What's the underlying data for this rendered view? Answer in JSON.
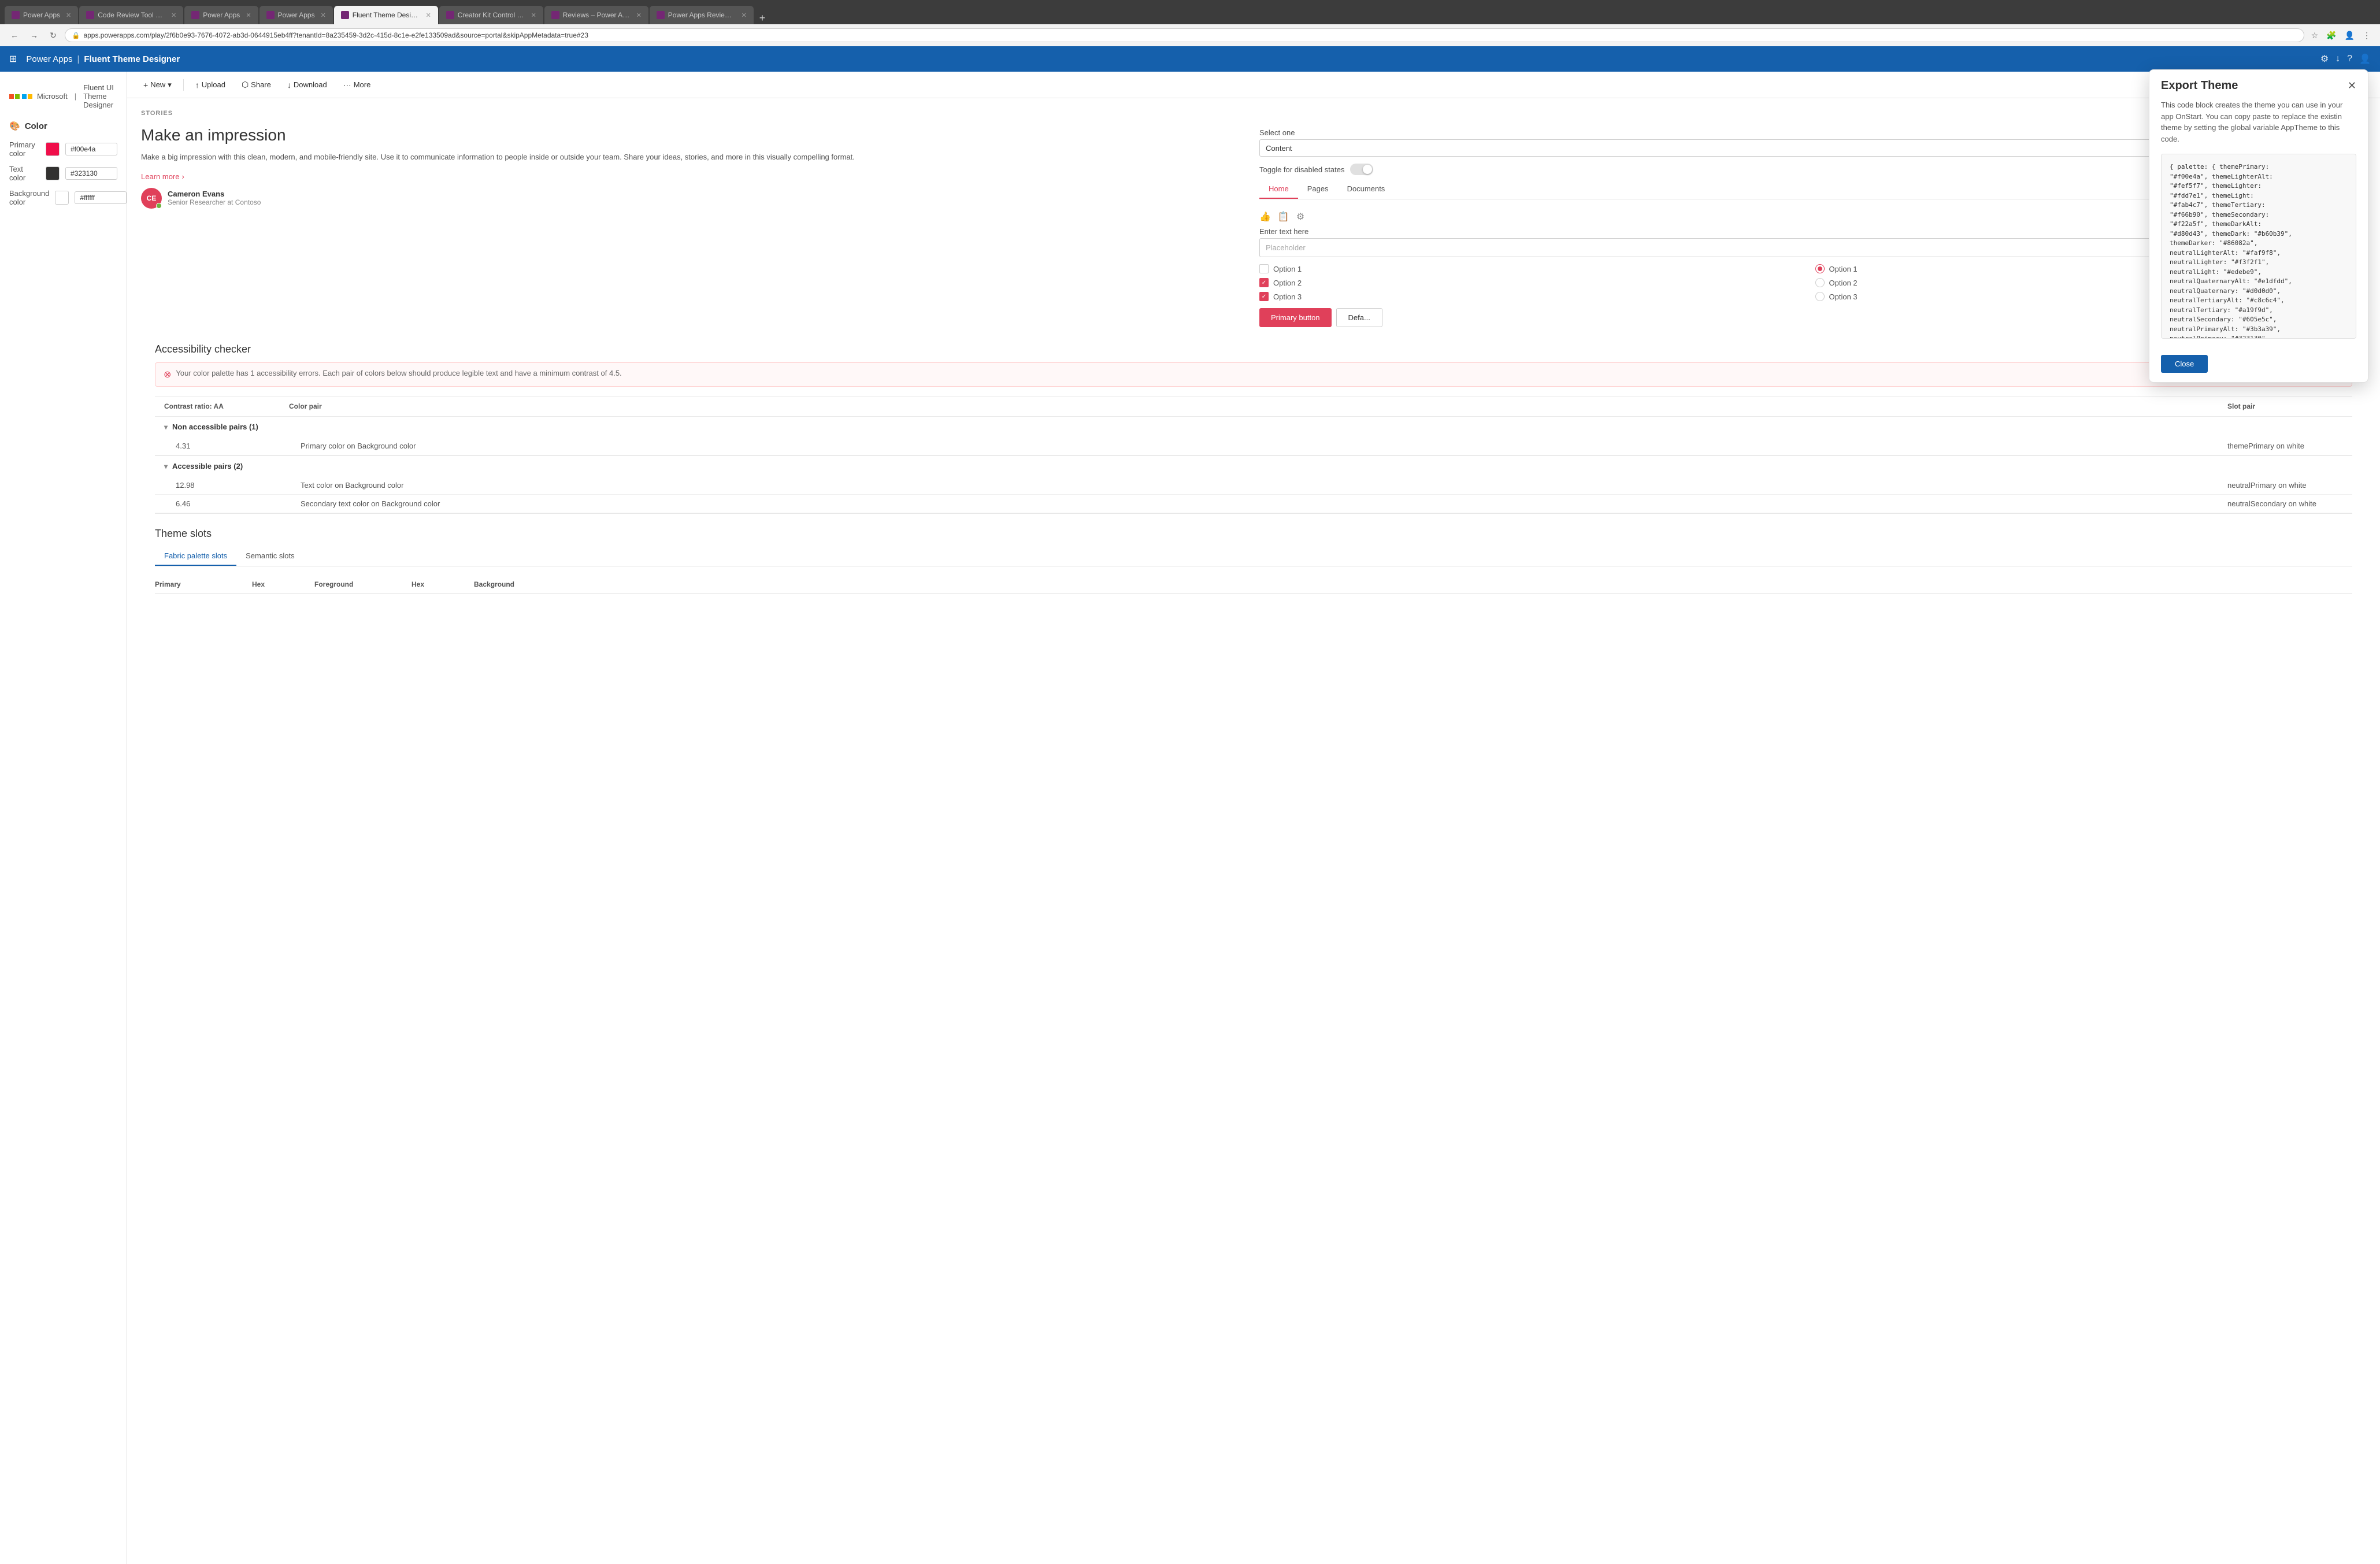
{
  "browser": {
    "tabs": [
      {
        "label": "Power Apps",
        "favicon_color": "#742774",
        "active": false
      },
      {
        "label": "Code Review Tool Experim...",
        "favicon_color": "#742774",
        "active": false
      },
      {
        "label": "Power Apps",
        "favicon_color": "#742774",
        "active": false
      },
      {
        "label": "Power Apps",
        "favicon_color": "#742774",
        "active": false
      },
      {
        "label": "Fluent Theme Designer -  ...",
        "favicon_color": "#742774",
        "active": true
      },
      {
        "label": "Creator Kit Control Refere...",
        "favicon_color": "#742774",
        "active": false
      },
      {
        "label": "Reviews – Power Apps",
        "favicon_color": "#742774",
        "active": false
      },
      {
        "label": "Power Apps Review Tool ...",
        "favicon_color": "#742774",
        "active": false
      }
    ],
    "url": "apps.powerapps.com/play/2f6b0e93-7676-4072-ab3d-0644915eb4ff?tenantId=8a235459-3d2c-415d-8c1e-e2fe133509ad&source=portal&skipAppMetadata=true#23"
  },
  "app": {
    "breadcrumb_root": "Power Apps",
    "breadcrumb_current": "Fluent Theme Designer",
    "logo_text": "Microsoft",
    "subtitle": "Fluent UI Theme Designer"
  },
  "sidebar": {
    "section_icon": "🎨",
    "section_title": "Color",
    "rows": [
      {
        "label": "Primary color",
        "color": "#f00e4a",
        "value": "#f00e4a"
      },
      {
        "label": "Text color",
        "color": "#323130",
        "value": "#323130"
      },
      {
        "label": "Background color",
        "color": "#ffffff",
        "value": "#ffffff"
      }
    ]
  },
  "toolbar": {
    "buttons": [
      {
        "label": "New",
        "icon": "+"
      },
      {
        "label": "Upload",
        "icon": "↑"
      },
      {
        "label": "Share",
        "icon": "⬡"
      },
      {
        "label": "Download",
        "icon": "↓"
      },
      {
        "label": "More",
        "icon": "•••"
      }
    ]
  },
  "stories": {
    "label": "STORIES",
    "heading": "Make an impression",
    "body": "Make a big impression with this clean, modern, and mobile-friendly site. Use it to communicate information to people inside or outside your team. Share your ideas, stories, and more in this visually compelling format.",
    "learn_more": "Learn more",
    "avatar_initials": "CE",
    "avatar_name": "Cameron Evans",
    "avatar_title": "Senior Researcher at Contoso"
  },
  "form": {
    "select_label": "Select one",
    "select_value": "Content",
    "text_label": "Enter text here",
    "text_placeholder": "Placeholder",
    "checkboxes": [
      {
        "label": "Option 1",
        "checked": false
      },
      {
        "label": "Option 2",
        "checked": true
      },
      {
        "label": "Option 3",
        "checked": true
      }
    ],
    "radios": [
      {
        "label": "Option 1",
        "checked": true
      },
      {
        "label": "Option 2",
        "checked": false
      },
      {
        "label": "Option 3",
        "checked": false
      }
    ],
    "primary_button": "Primary button",
    "default_button": "Defa..."
  },
  "toggle": {
    "label": "Toggle for disabled states"
  },
  "pivot": {
    "items": [
      {
        "label": "Home",
        "active": true
      },
      {
        "label": "Pages",
        "active": false
      },
      {
        "label": "Documents",
        "active": false
      }
    ]
  },
  "accessibility": {
    "title": "Accessibility checker",
    "error_text": "Your color palette has 1 accessibility errors. Each pair of colors below should produce legible text and have a minimum contrast of 4.5.",
    "table_headers": [
      "Contrast ratio: AA",
      "Color pair",
      "Slot pair"
    ],
    "non_accessible_label": "Non accessible pairs (1)",
    "non_accessible_rows": [
      {
        "ratio": "4.31",
        "pair": "Primary color on Background color",
        "slot": "themePrimary on white"
      }
    ],
    "accessible_label": "Accessible pairs (2)",
    "accessible_rows": [
      {
        "ratio": "12.98",
        "pair": "Text color on Background color",
        "slot": "neutralPrimary on white"
      },
      {
        "ratio": "6.46",
        "pair": "Secondary text color on Background color",
        "slot": "neutralSecondary on white"
      }
    ]
  },
  "theme_slots": {
    "title": "Theme slots",
    "tabs": [
      {
        "label": "Fabric palette slots",
        "active": true
      },
      {
        "label": "Semantic slots",
        "active": false
      }
    ],
    "columns": [
      "Primary",
      "Hex",
      "Foreground",
      "Hex",
      "Background"
    ]
  },
  "export_panel": {
    "title": "Export Theme",
    "description": "This code block creates the theme you can use in your app OnStart. You can copy paste to replace the existin theme by setting the global variable AppTheme to this code.",
    "code": "{ palette: { themePrimary:\n\"#f00e4a\", themeLighterAlt:\n\"#fef5f7\", themeLighter:\n\"#fdd7e1\", themeLight:\n\"#fab4c7\", themeTertiary:\n\"#f66b90\", themeSecondary:\n\"#f22a5f\", themeDarkAlt:\n\"#d80d43\", themeDark: \"#b60b39\",\nthemeDarker: \"#86082a\",\nneutralLighterAlt: \"#faf9f8\",\nneutralLighter: \"#f3f2f1\",\nneutralLight: \"#edebe9\",\nneutralQuaternaryAlt: \"#e1dfdd\",\nneutralQuaternary: \"#d0d0d0\",\nneutralTertiaryAlt: \"#c8c6c4\",\nneutralTertiary: \"#a19f9d\",\nneutralSecondary: \"#605e5c\",\nneutralPrimaryAlt: \"#3b3a39\",\nneutralPrimary: \"#323130\",\nneutralDark: \"#201f1e\", black:\n\"#000000\", white: \"#ffffff\" }}",
    "close_button": "Close"
  }
}
